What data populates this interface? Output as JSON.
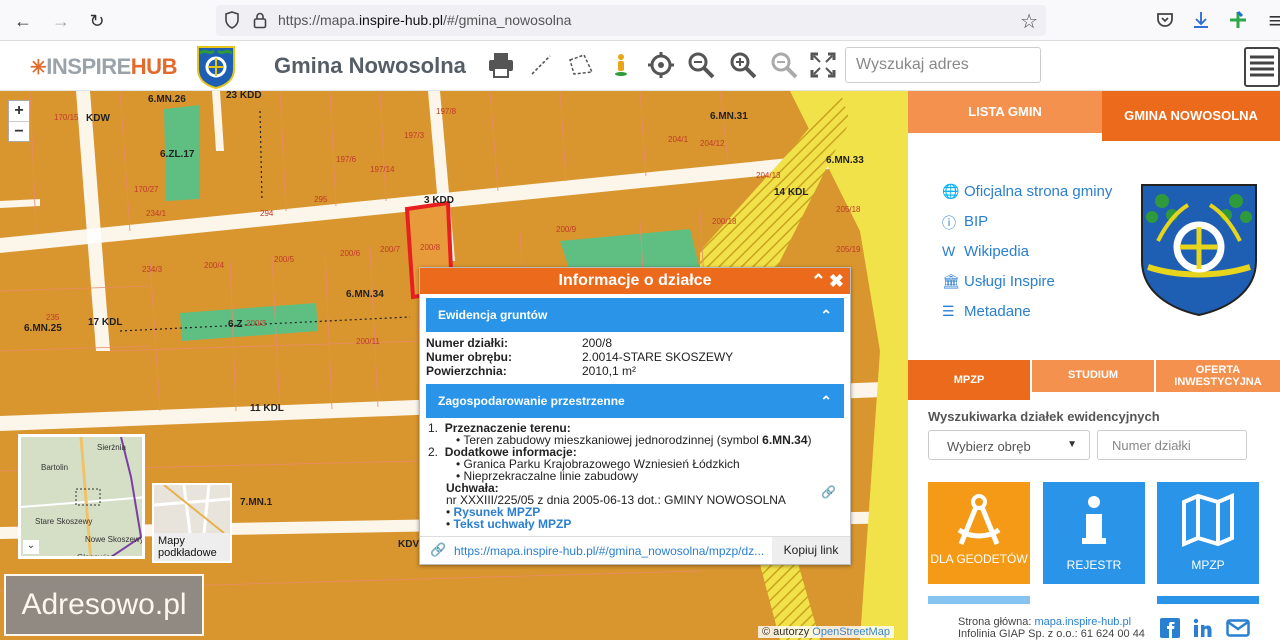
{
  "browser": {
    "url_prefix": "https://mapa.",
    "url_domain": "inspire-hub.pl",
    "url_path": "/#/gmina_nowosolna"
  },
  "header": {
    "logo_part1": "INSPIRE",
    "logo_part2": "HUB",
    "title": "Gmina Nowosolna",
    "search_placeholder": "Wyszukaj adres"
  },
  "map": {
    "zoom_in": "+",
    "zoom_out": "−",
    "labels": [
      {
        "t": "6.MN.26"
      },
      {
        "t": "23 KDD"
      },
      {
        "t": "KDW"
      },
      {
        "t": "6.ZL.17"
      },
      {
        "t": "170/15"
      },
      {
        "t": "170/27"
      },
      {
        "t": "197/3"
      },
      {
        "t": "197/6"
      },
      {
        "t": "197/14"
      },
      {
        "t": "197/8"
      },
      {
        "t": "6.MN.31"
      },
      {
        "t": "6.MN.33"
      },
      {
        "t": "14 KDL"
      },
      {
        "t": "3 KDD"
      },
      {
        "t": "294"
      },
      {
        "t": "295"
      },
      {
        "t": "200/8"
      },
      {
        "t": "200/9"
      },
      {
        "t": "200/18"
      },
      {
        "t": "234/3"
      },
      {
        "t": "200/4"
      },
      {
        "t": "200/5"
      },
      {
        "t": "200/6"
      },
      {
        "t": "200/7"
      },
      {
        "t": "6.MN.34"
      },
      {
        "t": "17 KDL"
      },
      {
        "t": "6.MN.25"
      },
      {
        "t": "6.Z"
      },
      {
        "t": "200/3"
      },
      {
        "t": "11 KDL"
      },
      {
        "t": "7.MN.1"
      },
      {
        "t": "KDV"
      },
      {
        "t": "204/1"
      },
      {
        "t": "204/12"
      },
      {
        "t": "204/13"
      },
      {
        "t": "205/18"
      },
      {
        "t": "205/19"
      },
      {
        "t": "234/1"
      },
      {
        "t": "235"
      },
      {
        "t": "200/11"
      }
    ],
    "minimap_places": [
      "Sierżnia",
      "Bartolin",
      "Stare Skoszewy",
      "Nowe Skoszewy",
      "Głogowiec"
    ],
    "basemap_label_1": "Mapy",
    "basemap_label_2": "podkładowe",
    "watermark": "Adresowo.pl",
    "attribution_prefix": "© autorzy ",
    "attribution_link": "OpenStreetMap"
  },
  "popup": {
    "title": "Informacje o działce",
    "section1_title": "Ewidencja gruntów",
    "fields": [
      {
        "k": "Numer działki:",
        "v": "200/8"
      },
      {
        "k": "Numer obrębu:",
        "v": "2.0014-STARE SKOSZEWY"
      },
      {
        "k": "Powierzchnia:",
        "v": "2010,1 m²"
      }
    ],
    "section2_title": "Zagospodarowanie przestrzenne",
    "item1_num": "1.",
    "item1_head": "Przeznaczenie terenu:",
    "item1_text": "Teren zabudowy mieszkaniowej jednorodzinnej (symbol ",
    "item1_symbol": "6.MN.34",
    "item1_close": ")",
    "item2_num": "2.",
    "item2_head": "Dodatkowe informacje:",
    "item2_a": "Granica Parku Krajobrazowego Wzniesień Łódzkich",
    "item2_b": "Nieprzekraczalne linie zabudowy",
    "uchwala_label": "Uchwała:",
    "uchwala_text": "nr XXXIII/225/05 z dnia 2005-06-13 dot.: GMINY NOWOSOLNA",
    "link_rysunek": "Rysunek MPZP",
    "link_tekst": "Tekst uchwały MPZP",
    "share_url": "https://mapa.inspire-hub.pl/#/gmina_nowosolna/mpzp/dz...",
    "copy_label": "Kopiuj link"
  },
  "sidebar": {
    "tab_list": "LISTA GMIN",
    "tab_current": "GMINA NOWOSOLNA",
    "links": [
      {
        "label": "Oficjalna strona gminy",
        "icon": "globe-icon"
      },
      {
        "label": "BIP",
        "icon": "info-icon"
      },
      {
        "label": "Wikipedia",
        "icon": "wikipedia-icon"
      },
      {
        "label": "Usługi Inspire",
        "icon": "bank-icon"
      },
      {
        "label": "Metadane",
        "icon": "database-icon"
      }
    ],
    "tabs2": [
      "MPZP",
      "STUDIUM",
      "OFERTA INWESTYCYJNA"
    ],
    "finder_title": "Wyszukiwarka działek ewidencyjnych",
    "select_value": "Wybierz obręb",
    "parcel_placeholder": "Numer działki",
    "tiles": [
      {
        "label": "DLA GEODETÓW",
        "color": "#f59a16"
      },
      {
        "label": "REJESTR",
        "color": "#2a95e8"
      },
      {
        "label": "MPZP",
        "color": "#2a95e8"
      }
    ],
    "footer_line1_prefix": "Strona główna: ",
    "footer_line1_link": "mapa.inspire-hub.pl",
    "footer_line2": "Infolinia GIAP Sp. z o.o.: 61 624 00 44"
  },
  "colors": {
    "orange": "#ec6a1b",
    "light_orange": "#f5914e",
    "blue": "#2a95e8",
    "map_base": "#d9962e"
  }
}
